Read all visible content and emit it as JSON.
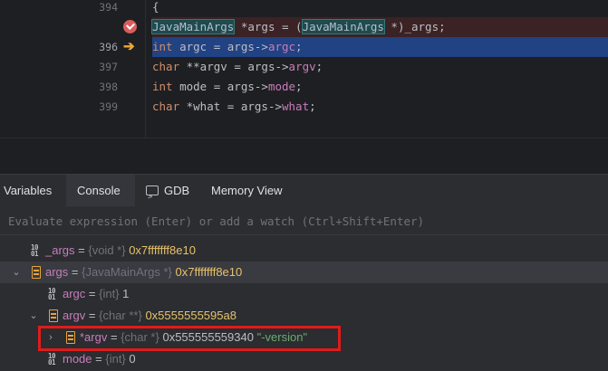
{
  "editor": {
    "lines": [
      {
        "number": "394",
        "gutter": "",
        "kind": "normal"
      },
      {
        "number": "",
        "gutter": "breakpoint",
        "kind": "bp"
      },
      {
        "number": "396",
        "gutter": "exec-arrow",
        "kind": "exec"
      },
      {
        "number": "397",
        "gutter": "",
        "kind": "normal"
      },
      {
        "number": "398",
        "gutter": "",
        "kind": "normal"
      },
      {
        "number": "399",
        "gutter": "",
        "kind": "normal"
      }
    ],
    "code": {
      "l394": "{",
      "l395_type1": "JavaMainArgs",
      "l395_mid": " *args = (",
      "l395_type2": "JavaMainArgs",
      "l395_end": " *)_args;",
      "l396_kw": "int",
      "l396_mid": " argc = args->",
      "l396_field": "argc",
      "l396_end": ";",
      "l397_kw": "char",
      "l397_mid": " **argv = args->",
      "l397_field": "argv",
      "l397_end": ";",
      "l398_kw": "int",
      "l398_mid": " mode = args->",
      "l398_field": "mode",
      "l398_end": ";",
      "l399_kw": "char",
      "l399_mid": " *what = args->",
      "l399_field": "what",
      "l399_end": ";"
    },
    "gutter_icons": {
      "breakpoint": "breakpoint-check-icon",
      "exec": "execution-arrow-icon"
    }
  },
  "debug": {
    "tabs": [
      {
        "label": "Variables",
        "active": false
      },
      {
        "label": "Console",
        "active": true
      },
      {
        "label": "GDB",
        "active": false,
        "icon": "terminal-icon"
      },
      {
        "label": "Memory View",
        "active": false
      }
    ],
    "evaluate_placeholder": "Evaluate expression (Enter) or add a watch (Ctrl+Shift+Enter)",
    "variables": [
      {
        "name": "_args",
        "eq": " = ",
        "type": "{void *}",
        "value": "0x7fffffff8e10",
        "icon": "binary-icon",
        "expand": "none"
      },
      {
        "name": "args",
        "eq": " = ",
        "type": "{JavaMainArgs *}",
        "value": "0x7fffffff8e10",
        "icon": "struct-icon",
        "expand": "expanded",
        "selected": true
      },
      {
        "name": "argc",
        "eq": " = ",
        "type": "{int}",
        "value": "1",
        "icon": "binary-icon",
        "expand": "none"
      },
      {
        "name": "argv",
        "eq": " = ",
        "type": "{char **}",
        "value": "0x5555555595a8",
        "icon": "struct-icon",
        "expand": "expanded"
      },
      {
        "name": "*argv",
        "eq": " = ",
        "type": "{char *}",
        "value": "0x555555559340",
        "string": "\"-version\"",
        "icon": "struct-icon",
        "expand": "collapsed",
        "highlighted": true
      },
      {
        "name": "mode",
        "eq": " = ",
        "type": "{int}",
        "value": "0",
        "icon": "binary-icon",
        "expand": "none"
      }
    ],
    "binary_icon_text": "10\n01"
  },
  "colors": {
    "accent": "#3574f0",
    "breakpoint": "#db5c5c",
    "exec_line": "#214283",
    "highlight_box": "#e01b1b"
  }
}
